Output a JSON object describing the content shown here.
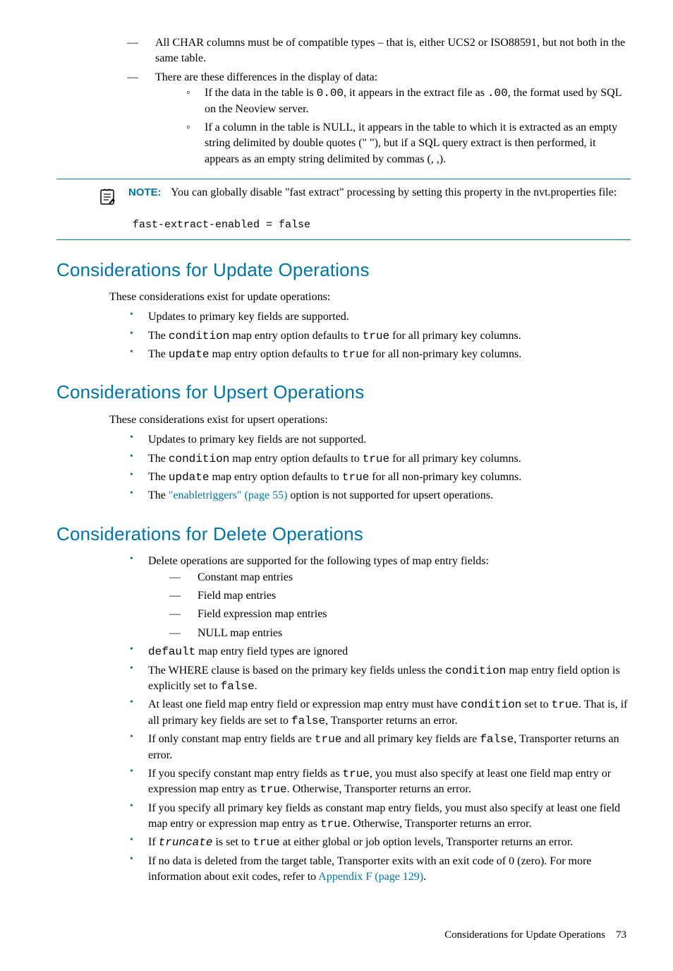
{
  "top_list": {
    "item1": "All CHAR columns must be of compatible types – that is, either UCS2 or ISO88591, but not both in the same table.",
    "item2": "There are these differences in the display of data:",
    "sub1_a": "If the data in the table is ",
    "sub1_code1": "0.00",
    "sub1_b": ", it appears in the extract file as ",
    "sub1_code2": ".00",
    "sub1_c": ", the format used by SQL on the Neoview server.",
    "sub2": "If a column in the table is NULL, it appears in the table to which it is extracted as an empty string delimited by double quotes (\" \"), but if a SQL query extract is then performed, it appears as an empty string delimited by commas (, ,)."
  },
  "note": {
    "label": "NOTE:",
    "text": "You can globally disable \"fast extract\" processing by setting this property in the nvt.properties file:",
    "code": "fast-extract-enabled = false"
  },
  "section1": {
    "title": "Considerations for Update Operations",
    "intro": "These considerations exist for update operations:",
    "b1": "Updates to primary key fields are supported.",
    "b2_a": "The ",
    "b2_code1": "condition",
    "b2_b": " map entry option defaults to ",
    "b2_code2": "true",
    "b2_c": " for all primary key columns.",
    "b3_a": "The ",
    "b3_code1": "update",
    "b3_b": " map entry option defaults to ",
    "b3_code2": "true",
    "b3_c": " for all non-primary key columns."
  },
  "section2": {
    "title": "Considerations for Upsert Operations",
    "intro": "These considerations exist for upsert operations:",
    "b1": "Updates to primary key fields are not supported.",
    "b2_a": "The ",
    "b2_code1": "condition",
    "b2_b": " map entry option defaults to ",
    "b2_code2": "true",
    "b2_c": " for all primary key columns.",
    "b3_a": "The ",
    "b3_code1": "update",
    "b3_b": " map entry option defaults to ",
    "b3_code2": "true",
    "b3_c": " for all non-primary key columns.",
    "b4_a": "The ",
    "b4_link": "\"enabletriggers\" (page 55)",
    "b4_b": " option is not supported for upsert operations."
  },
  "section3": {
    "title": "Considerations for Delete Operations",
    "b1": "Delete operations are supported for the following types of map entry fields:",
    "b1_d1": "Constant map entries",
    "b1_d2": "Field map entries",
    "b1_d3": "Field expression map entries",
    "b1_d4": "NULL map entries",
    "b2_code": "default",
    "b2_b": " map entry field types are ignored",
    "b3_a": "The WHERE clause is based on the primary key fields unless the ",
    "b3_code": "condition",
    "b3_b": " map entry field option is explicitly set to ",
    "b3_code2": "false",
    "b3_c": ".",
    "b4_a": "At least one field map entry field or expression map entry must have ",
    "b4_code1": "condition",
    "b4_b": " set to ",
    "b4_code2": "true",
    "b4_c": ". That is, if all primary key fields are set to ",
    "b4_code3": "false",
    "b4_d": ", Transporter returns an error.",
    "b5_a": "If only constant map entry fields are ",
    "b5_code1": "true",
    "b5_b": " and all primary key fields are ",
    "b5_code2": "false",
    "b5_c": ", Transporter returns an error.",
    "b6_a": "If you specify constant map entry fields as ",
    "b6_code1": "true",
    "b6_b": ", you must also specify at least one field map entry or expression map entry as ",
    "b6_code2": "true",
    "b6_c": ". Otherwise, Transporter returns an error.",
    "b7_a": "If you specify all primary key fields as constant map entry fields, you must also specify at least one field map entry or expression map entry as ",
    "b7_code": "true",
    "b7_b": ". Otherwise, Transporter returns an error.",
    "b8_a": "If ",
    "b8_code1": "truncate",
    "b8_b": " is set to ",
    "b8_code2": "true",
    "b8_c": " at either global or job option levels, Transporter returns an error.",
    "b9_a": "If no data is deleted from the target table, Transporter exits with an exit code of 0 (zero). For more information about exit codes, refer to ",
    "b9_link": "Appendix F (page 129)",
    "b9_b": "."
  },
  "footer": {
    "text": "Considerations for Update Operations",
    "page": "73"
  }
}
